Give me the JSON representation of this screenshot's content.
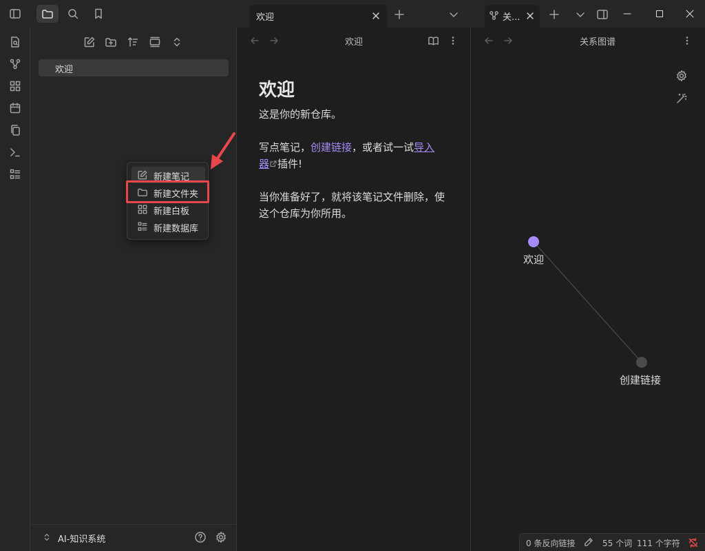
{
  "tabs": [
    {
      "label": "欢迎",
      "active": true
    },
    {
      "label": "关..."
    }
  ],
  "sidebar": {
    "files": [
      "欢迎"
    ],
    "vault_name": "AI-知识系统"
  },
  "context_menu": {
    "items": [
      {
        "label": "新建笔记",
        "icon": "edit-icon"
      },
      {
        "label": "新建文件夹",
        "icon": "folder-icon",
        "highlighted": true
      },
      {
        "label": "新建白板",
        "icon": "canvas-icon"
      },
      {
        "label": "新建数据库",
        "icon": "database-icon"
      }
    ]
  },
  "note": {
    "pane_title": "欢迎",
    "heading": "欢迎",
    "p1": "这是你的新仓库。",
    "p2_a": "写点笔记，",
    "p2_link": "创建链接",
    "p2_b": "，或者试一试",
    "p2_ext": "导入器",
    "p2_c": "插件!",
    "p3": "当你准备好了，就将该笔记文件删除，使这个仓库为你所用。"
  },
  "graph": {
    "pane_title": "关系图谱",
    "nodes": [
      {
        "label": "欢迎",
        "color": "#a68af9"
      },
      {
        "label": "创建链接",
        "color": "#4a4a4a"
      }
    ]
  },
  "status": {
    "backlinks": "0 条反向链接",
    "words": "55 个词",
    "chars": "111 个字符"
  },
  "colors": {
    "accent": "#a68af9",
    "annotation": "#e8474c"
  }
}
